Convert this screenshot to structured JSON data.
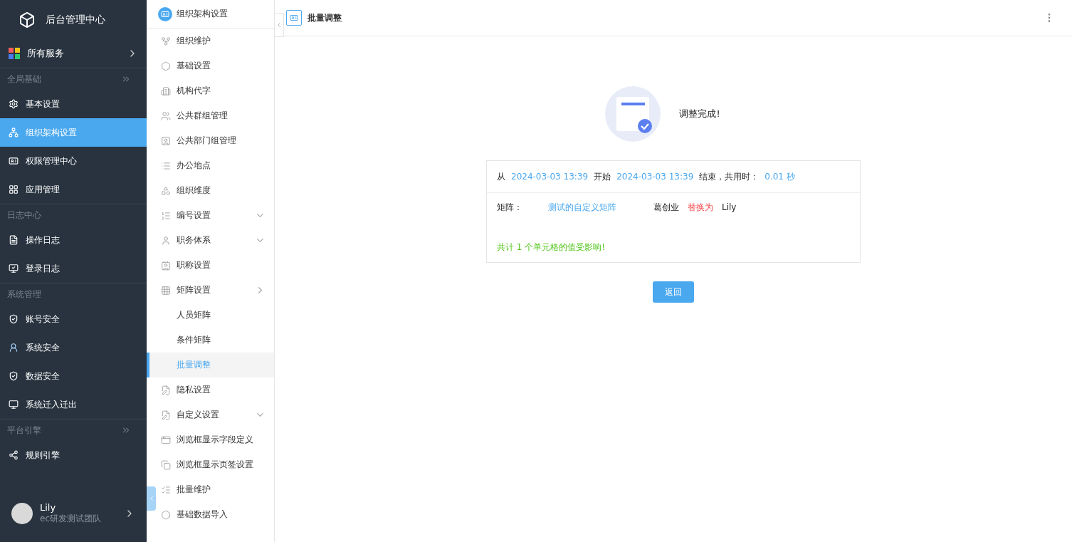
{
  "app": {
    "title": "后台管理中心"
  },
  "all_services": {
    "label": "所有服务"
  },
  "nav_sections": [
    {
      "title": "全局基础",
      "collapsible": true,
      "items": [
        {
          "label": "基本设置",
          "selected": false
        },
        {
          "label": "组织架构设置",
          "selected": true
        },
        {
          "label": "权限管理中心",
          "selected": false
        },
        {
          "label": "应用管理",
          "selected": false
        }
      ]
    },
    {
      "title": "日志中心",
      "collapsible": false,
      "items": [
        {
          "label": "操作日志",
          "selected": false
        },
        {
          "label": "登录日志",
          "selected": false
        }
      ]
    },
    {
      "title": "系统管理",
      "collapsible": false,
      "items": [
        {
          "label": "账号安全",
          "selected": false
        },
        {
          "label": "系统安全",
          "selected": false
        },
        {
          "label": "数据安全",
          "selected": false
        },
        {
          "label": "系统迁入迁出",
          "selected": false
        }
      ]
    },
    {
      "title": "平台引擎",
      "collapsible": true,
      "items": [
        {
          "label": "规则引擎",
          "selected": false
        }
      ]
    }
  ],
  "user": {
    "name": "Lily",
    "team": "ec研发测试团队"
  },
  "subnav": {
    "title": "组织架构设置",
    "items": [
      {
        "label": "组织维护",
        "selected": false
      },
      {
        "label": "基础设置",
        "selected": false
      },
      {
        "label": "机构代字",
        "selected": false
      },
      {
        "label": "公共群组管理",
        "selected": false
      },
      {
        "label": "公共部门组管理",
        "selected": false
      },
      {
        "label": "办公地点",
        "selected": false
      },
      {
        "label": "组织维度",
        "selected": false
      },
      {
        "label": "编号设置",
        "selected": false,
        "expanded": false
      },
      {
        "label": "职务体系",
        "selected": false,
        "expanded": false
      },
      {
        "label": "职称设置",
        "selected": false
      },
      {
        "label": "矩阵设置",
        "selected": false,
        "expanded": true,
        "children": [
          {
            "label": "人员矩阵",
            "selected": false
          },
          {
            "label": "条件矩阵",
            "selected": false
          },
          {
            "label": "批量调整",
            "selected": true
          }
        ]
      },
      {
        "label": "隐私设置",
        "selected": false
      },
      {
        "label": "自定义设置",
        "selected": false,
        "expanded": false
      },
      {
        "label": "浏览框显示字段定义",
        "selected": false
      },
      {
        "label": "浏览框显示页签设置",
        "selected": false
      },
      {
        "label": "批量维护",
        "selected": false
      },
      {
        "label": "基础数据导入",
        "selected": false
      }
    ]
  },
  "header": {
    "title": "批量调整"
  },
  "result": {
    "title": "调整完成!",
    "summary": [
      {
        "kind": "text",
        "text": "从"
      },
      {
        "kind": "value",
        "text": "2024-03-03 13:39"
      },
      {
        "kind": "text",
        "text": "开始"
      },
      {
        "kind": "value",
        "text": "2024-03-03 13:39"
      },
      {
        "kind": "text",
        "text": "结束，共用时："
      },
      {
        "kind": "value",
        "text": "0.01 秒"
      }
    ],
    "detail": [
      {
        "kind": "label",
        "text": "矩阵："
      },
      {
        "kind": "value",
        "text": "测试的自定义矩阵"
      },
      {
        "kind": "text",
        "text": "葛创业"
      },
      {
        "kind": "action",
        "text": "替换为"
      },
      {
        "kind": "text",
        "text": "Lily"
      }
    ],
    "footer": "共计 1 个单元格的值受影响!",
    "button": "返回"
  }
}
